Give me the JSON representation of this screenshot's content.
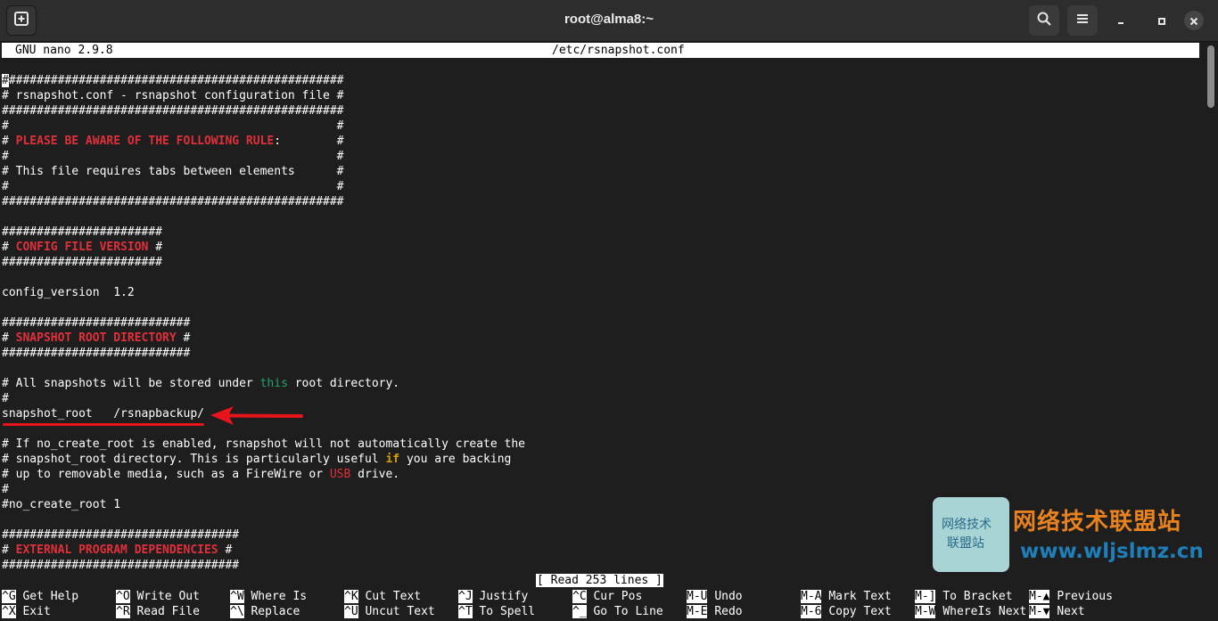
{
  "window": {
    "title": "root@alma8:~",
    "buttons": {
      "new_tab_icon": "new-tab-icon",
      "search_icon": "search-icon",
      "menu_icon": "hamburger-menu-icon",
      "minimize_icon": "minimize-icon",
      "maximize_icon": "maximize-icon",
      "close_icon": "close-icon"
    }
  },
  "nano": {
    "version": "GNU nano 2.9.8",
    "filename": "/etc/rsnapshot.conf",
    "status": "[ Read 253 lines ]"
  },
  "editor": {
    "lines": [
      [
        {
          "t": "#",
          "c": "cursor"
        },
        {
          "t": "################################################"
        }
      ],
      [
        {
          "t": "# rsnapshot.conf - rsnapshot configuration file #"
        }
      ],
      [
        {
          "t": "#################################################"
        }
      ],
      [
        {
          "t": "#                                               #"
        }
      ],
      [
        {
          "t": "# "
        },
        {
          "t": "PLEASE BE AWARE OF THE FOLLOWING RULE",
          "c": "red"
        },
        {
          "t": ":        #"
        }
      ],
      [
        {
          "t": "#                                               #"
        }
      ],
      [
        {
          "t": "# This file requires tabs between elements      #"
        }
      ],
      [
        {
          "t": "#                                               #"
        }
      ],
      [
        {
          "t": "#################################################"
        }
      ],
      [
        {
          "t": ""
        }
      ],
      [
        {
          "t": "#######################"
        }
      ],
      [
        {
          "t": "# "
        },
        {
          "t": "CONFIG FILE VERSION",
          "c": "red"
        },
        {
          "t": " #"
        }
      ],
      [
        {
          "t": "#######################"
        }
      ],
      [
        {
          "t": ""
        }
      ],
      [
        {
          "t": "config_version  1.2"
        }
      ],
      [
        {
          "t": ""
        }
      ],
      [
        {
          "t": "###########################"
        }
      ],
      [
        {
          "t": "# "
        },
        {
          "t": "SNAPSHOT ROOT DIRECTORY",
          "c": "red"
        },
        {
          "t": " #"
        }
      ],
      [
        {
          "t": "###########################"
        }
      ],
      [
        {
          "t": ""
        }
      ],
      [
        {
          "t": "# All snapshots will be stored under "
        },
        {
          "t": "this",
          "c": "green"
        },
        {
          "t": " root directory."
        }
      ],
      [
        {
          "t": "#"
        }
      ],
      [
        {
          "t": "snapshot_root   /rsnapbackup/"
        }
      ],
      [
        {
          "t": ""
        }
      ],
      [
        {
          "t": "# If no_create_root is enabled, rsnapshot will not automatically create the"
        }
      ],
      [
        {
          "t": "# snapshot_root directory. This is particularly useful "
        },
        {
          "t": "if",
          "c": "yellow"
        },
        {
          "t": " you are backing"
        }
      ],
      [
        {
          "t": "# up to removable media, such as a FireWire or "
        },
        {
          "t": "USB",
          "c": "redplain"
        },
        {
          "t": " drive."
        }
      ],
      [
        {
          "t": "#"
        }
      ],
      [
        {
          "t": "#no_create_root 1"
        }
      ],
      [
        {
          "t": ""
        }
      ],
      [
        {
          "t": "##################################"
        }
      ],
      [
        {
          "t": "# "
        },
        {
          "t": "EXTERNAL PROGRAM DEPENDENCIES",
          "c": "red"
        },
        {
          "t": " #"
        }
      ],
      [
        {
          "t": "##################################"
        }
      ]
    ]
  },
  "shortcuts": [
    {
      "key": "^G",
      "label": "Get Help"
    },
    {
      "key": "^O",
      "label": "Write Out"
    },
    {
      "key": "^W",
      "label": "Where Is"
    },
    {
      "key": "^K",
      "label": "Cut Text"
    },
    {
      "key": "^J",
      "label": "Justify"
    },
    {
      "key": "^C",
      "label": "Cur Pos"
    },
    {
      "key": "M-U",
      "label": "Undo"
    },
    {
      "key": "M-A",
      "label": "Mark Text"
    },
    {
      "key": "M-]",
      "label": "To Bracket"
    },
    {
      "key": "M-▲",
      "label": "Previous"
    },
    {
      "key": "^X",
      "label": "Exit"
    },
    {
      "key": "^R",
      "label": "Read File"
    },
    {
      "key": "^\\",
      "label": "Replace"
    },
    {
      "key": "^U",
      "label": "Uncut Text"
    },
    {
      "key": "^T",
      "label": "To Spell"
    },
    {
      "key": "^_",
      "label": "Go To Line"
    },
    {
      "key": "M-E",
      "label": "Redo"
    },
    {
      "key": "M-6",
      "label": "Copy Text"
    },
    {
      "key": "M-W",
      "label": "WhereIs Next"
    },
    {
      "key": "M-▼",
      "label": "Next"
    }
  ],
  "watermark": {
    "badge_line1": "网络技术",
    "badge_line2": "联盟站",
    "title": "网络技术联盟站",
    "url": "www.wljslmz.cn"
  },
  "colors": {
    "background": "#1e1e1e",
    "titlebar": "#2d2d2d",
    "keyword_red": "#e0303b",
    "keyword_green": "#26a269",
    "keyword_yellow": "#d7a000",
    "annotation": "#e8141b"
  }
}
